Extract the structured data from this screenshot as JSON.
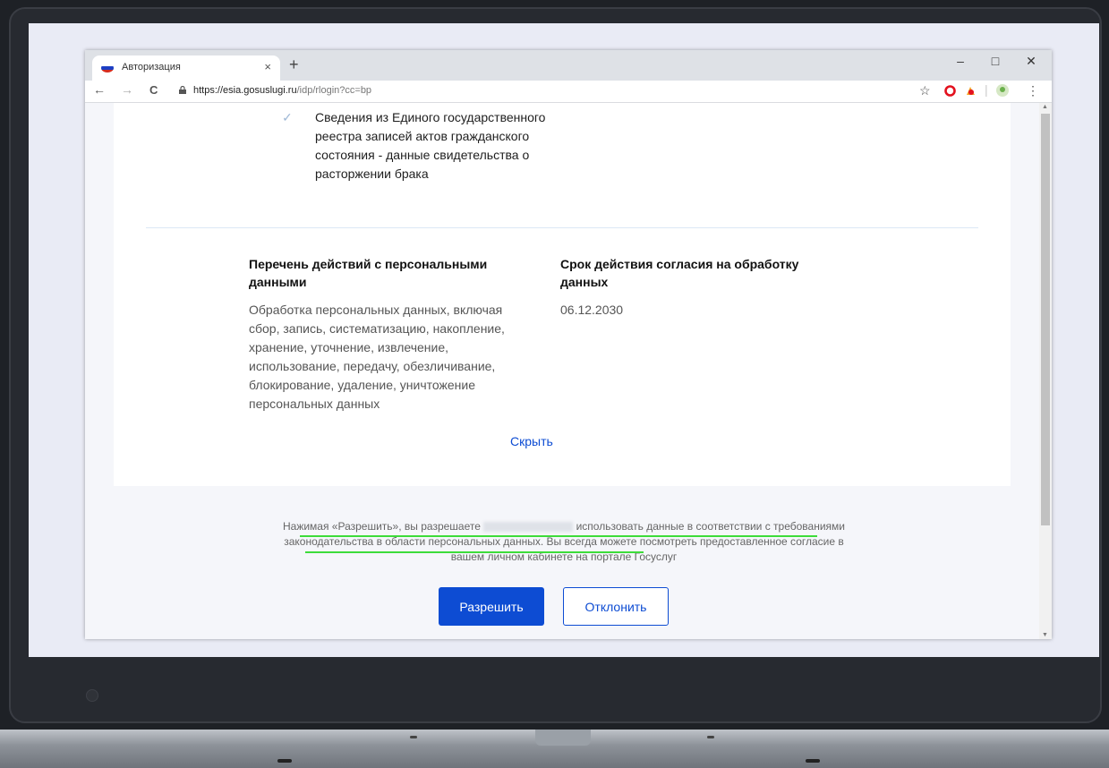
{
  "browser": {
    "tab_title": "Авторизация",
    "tab_close": "×",
    "new_tab": "+",
    "url_host": "https://esia.gosuslugi.ru",
    "url_path": "/idp/rlogin?cc=bp",
    "win_minimize": "–",
    "win_maximize": "□",
    "win_close": "✕",
    "back": "←",
    "forward": "→",
    "reload": "C",
    "star": "☆",
    "menu": "⋮"
  },
  "consent": {
    "item_text": "Сведения из Единого государственного реестра записей актов гражданского состояния - данные свидетельства о расторжении брака",
    "actions_title": "Перечень действий с персональными данными",
    "actions_text": "Обработка персональных данных, включая сбор, запись, систематизацию, накопление, хранение, уточнение, извлечение, использование, передачу, обезличивание, блокирование, удаление, уничтожение персональных данных",
    "term_title": "Срок действия согласия на обработку данных",
    "term_value": "06.12.2030",
    "hide_link": "Скрыть"
  },
  "notice": {
    "part1": "Нажимая «Разрешить», вы разрешаете",
    "part2": "использовать данные в соответствии с требованиями законодательства в области персональных данных. Вы всегда можете посмотреть предоставленное согласие в вашем личном кабинете на портале Госуслуг"
  },
  "buttons": {
    "allow": "Разрешить",
    "deny": "Отклонить"
  },
  "colors": {
    "primary": "#0d4cd3",
    "highlight": "#3ddc3a"
  }
}
